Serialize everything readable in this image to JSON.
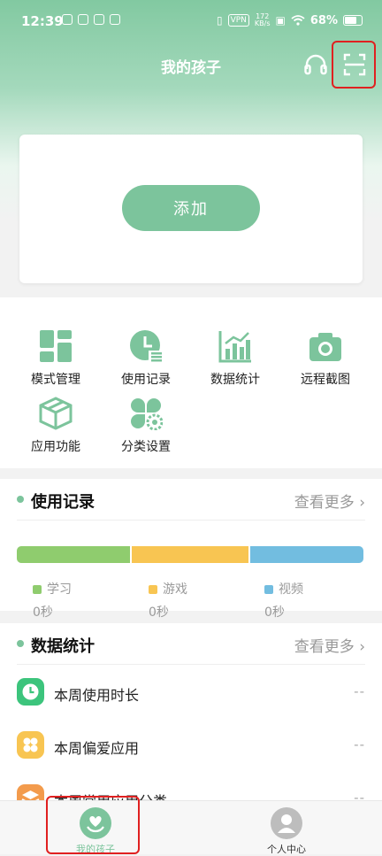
{
  "status_bar": {
    "time": "12:39",
    "vpn": "VPN",
    "speed_value": "172",
    "speed_unit": "KB/s",
    "battery": "68%"
  },
  "header": {
    "title": "我的孩子"
  },
  "add_card": {
    "button_label": "添加"
  },
  "features": [
    {
      "label": "模式管理",
      "icon": "grid-layout-icon"
    },
    {
      "label": "使用记录",
      "icon": "clock-list-icon"
    },
    {
      "label": "数据统计",
      "icon": "bar-chart-icon"
    },
    {
      "label": "远程截图",
      "icon": "camera-icon"
    },
    {
      "label": "应用功能",
      "icon": "box-icon"
    },
    {
      "label": "分类设置",
      "icon": "clover-gear-icon"
    }
  ],
  "usage": {
    "title": "使用记录",
    "more": "查看更多",
    "bar_fractions": [
      0.33,
      0.34,
      0.33
    ],
    "legend": [
      {
        "label": "学习",
        "value": "0秒",
        "color": "#8fcc6e"
      },
      {
        "label": "游戏",
        "value": "0秒",
        "color": "#f8c552"
      },
      {
        "label": "视频",
        "value": "0秒",
        "color": "#72bde0"
      }
    ]
  },
  "stats": {
    "title": "数据统计",
    "more": "查看更多",
    "rows": [
      {
        "label": "本周使用时长",
        "value": "--",
        "color": "#3cc47c",
        "icon": "clock-icon"
      },
      {
        "label": "本周偏爱应用",
        "value": "--",
        "color": "#f8c552",
        "icon": "clover-icon"
      },
      {
        "label": "本周常用应用分类",
        "value": "--",
        "color": "#f39b4c",
        "icon": "layers-icon"
      }
    ]
  },
  "navbar": {
    "items": [
      {
        "label": "我的孩子",
        "active": true
      },
      {
        "label": "个人中心",
        "active": false
      }
    ]
  },
  "colors": {
    "accent": "#7cc49c",
    "highlight": "#e02020"
  }
}
